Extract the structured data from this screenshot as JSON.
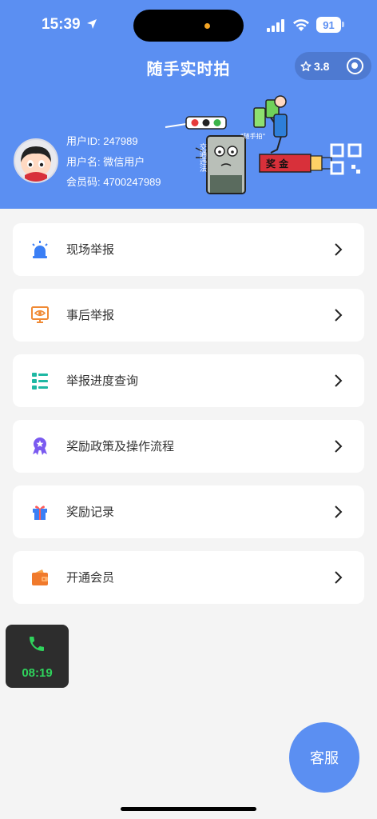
{
  "status_bar": {
    "time": "15:39",
    "battery": "91"
  },
  "header": {
    "title": "随手实时拍",
    "rating": "3.8"
  },
  "user": {
    "id_line": "用户ID: 247989",
    "name_line": "用户名: 微信用户",
    "code_line": "会员码: 4700247989"
  },
  "illustration": {
    "caption_quote": "\"随手拍\"",
    "caption_vertical": "交通违法",
    "reward_text": "奖 金"
  },
  "menu": [
    {
      "label": "现场举报",
      "icon": "alarm-light-icon"
    },
    {
      "label": "事后举报",
      "icon": "monitor-eye-icon"
    },
    {
      "label": "举报进度查询",
      "icon": "list-icon"
    },
    {
      "label": "奖励政策及操作流程",
      "icon": "medal-icon"
    },
    {
      "label": "奖励记录",
      "icon": "gift-icon"
    },
    {
      "label": "开通会员",
      "icon": "wallet-icon"
    }
  ],
  "call": {
    "duration": "08:19"
  },
  "service": {
    "label": "客服"
  },
  "colors": {
    "primary": "#5b8ff2",
    "background": "#f4f4f4",
    "call_green": "#2fd35c"
  }
}
